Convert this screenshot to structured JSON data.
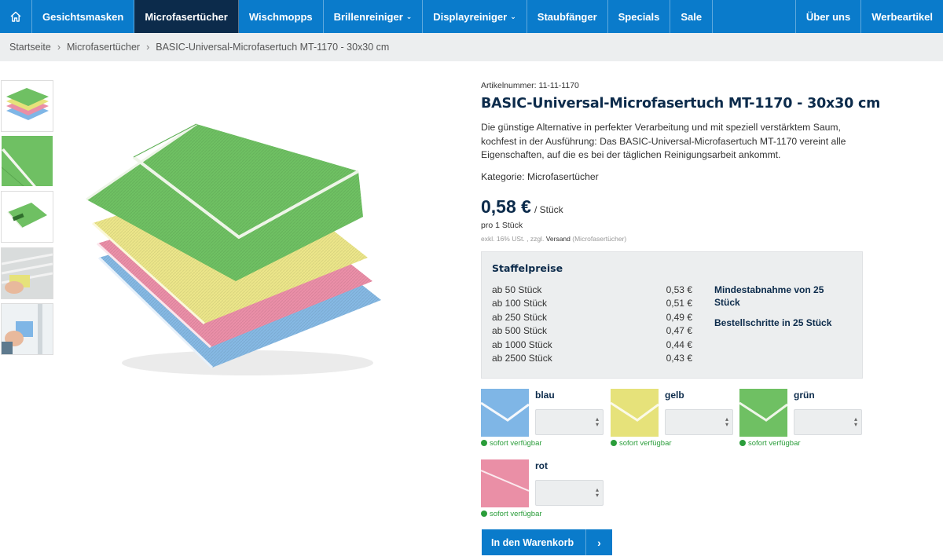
{
  "nav": {
    "items": [
      {
        "label": "Gesichtsmasken"
      },
      {
        "label": "Microfasertücher"
      },
      {
        "label": "Wischmopps"
      },
      {
        "label": "Brillenreiniger"
      },
      {
        "label": "Displayreiniger"
      },
      {
        "label": "Staubfänger"
      },
      {
        "label": "Specials"
      },
      {
        "label": "Sale"
      }
    ],
    "right": [
      {
        "label": "Über uns"
      },
      {
        "label": "Werbeartikel"
      }
    ],
    "active": "Microfasertücher",
    "home_icon": "home-icon",
    "dropdown_icon": "chevron-down-icon"
  },
  "breadcrumb": [
    "Startseite",
    "Microfasertücher",
    "BASIC-Universal-Microfasertuch MT-1170 - 30x30 cm"
  ],
  "product": {
    "article_label": "Artikelnummer: 11-11-1170",
    "title": "BASIC-Universal-Microfasertuch MT-1170 - 30x30 cm",
    "description": "Die günstige Alternative in perfekter Verarbeitung und mit speziell verstärktem Saum, kochfest in der Ausführung: Das BASIC-Universal-Microfasertuch MT-1170 vereint alle Eigenschaften, auf die es bei der täglichen Reinigungsarbeit ankommt.",
    "category": "Kategorie: Microfasertücher",
    "price": "0,58 €",
    "price_unit": "/ Stück",
    "per_piece": "pro 1 Stück",
    "tax_prefix": "exkl. 16% USt. , zzgl.",
    "shipping_link": "Versand",
    "tax_suffix": "(Microfasertücher)"
  },
  "staffel": {
    "title": "Staffelpreise",
    "tiers": [
      {
        "qty": "ab 50 Stück",
        "price": "0,53 €"
      },
      {
        "qty": "ab 100 Stück",
        "price": "0,51 €"
      },
      {
        "qty": "ab 250 Stück",
        "price": "0,49 €"
      },
      {
        "qty": "ab 500 Stück",
        "price": "0,47 €"
      },
      {
        "qty": "ab 1000 Stück",
        "price": "0,44 €"
      },
      {
        "qty": "ab 2500 Stück",
        "price": "0,43 €"
      }
    ],
    "min_order": "Mindestabnahme von 25 Stück",
    "steps": "Bestellschritte in 25 Stück"
  },
  "variants": [
    {
      "name": "blau",
      "color": "#7fb6e6",
      "availability": "sofort verfügbar"
    },
    {
      "name": "gelb",
      "color": "#e6e27a",
      "availability": "sofort verfügbar"
    },
    {
      "name": "grün",
      "color": "#6fc063",
      "availability": "sofort verfügbar"
    },
    {
      "name": "rot",
      "color": "#ea8fa6",
      "availability": "sofort verfügbar"
    }
  ],
  "cart": {
    "label": "In den Warenkorb",
    "icon": "chevron-right-icon"
  },
  "colors": {
    "primary": "#0a7bcb",
    "dark": "#0c2b4b",
    "available": "#2a9d3a",
    "panel": "#eceeef"
  }
}
